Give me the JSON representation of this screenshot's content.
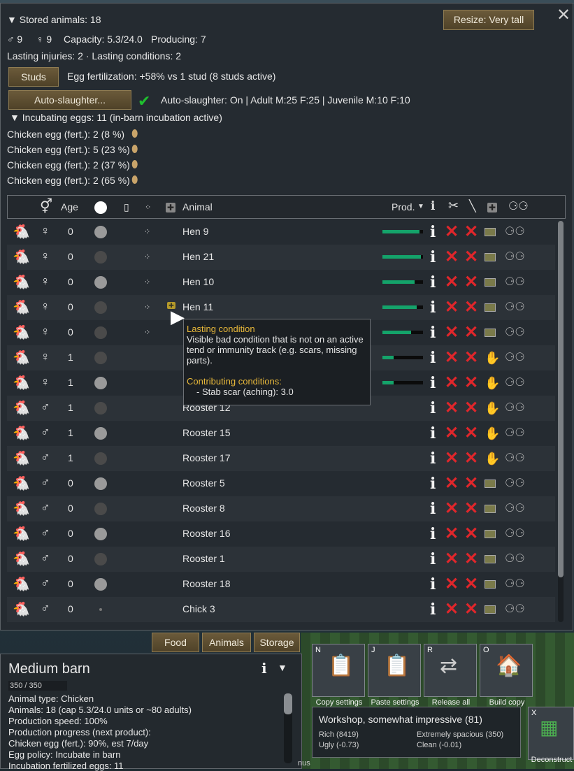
{
  "header_cut": "31557",
  "stored": "▼ Stored animals: 18",
  "resize_btn": "Resize: Very tall",
  "males": "9",
  "females": "9",
  "capacity": "Capacity: 5.3/24.0",
  "producing": "Producing: 7",
  "injuries": "Lasting injuries: 2 · Lasting conditions: 2",
  "studs_btn": "Studs",
  "egg_fert": "Egg fertilization: +58% vs 1 stud (8 studs active)",
  "autoslaughter_btn": "Auto-slaughter...",
  "autoslaughter_text": "Auto-slaughter: On | Adult M:25 F:25 | Juvenile M:10 F:10",
  "incubating": "▼ Incubating eggs: 11 (in-barn incubation active)",
  "eggs": [
    "Chicken egg (fert.): 2 (8 %)",
    "Chicken egg (fert.): 5 (23 %)",
    "Chicken egg (fert.): 2 (37 %)",
    "Chicken egg (fert.): 2 (65 %)"
  ],
  "columns": {
    "age": "Age",
    "animal": "Animal",
    "prod": "Prod."
  },
  "colors": {
    "bar": "#14a36a",
    "x": "#e0262b",
    "accent": "#e8b83a"
  },
  "animals": [
    {
      "sex": "♀",
      "age": "0",
      "name": "Hen 9",
      "circle": "#9a9a9a",
      "eggs": true,
      "prod": 0.92,
      "tend": "x",
      "icon": "hen-white"
    },
    {
      "sex": "♀",
      "age": "0",
      "name": "Hen 21",
      "circle": "#4a4a4a",
      "eggs": true,
      "prod": 0.95,
      "tend": "x",
      "icon": "hen-white"
    },
    {
      "sex": "♀",
      "age": "0",
      "name": "Hen 10",
      "circle": "#9a9a9a",
      "eggs": true,
      "prod": 0.8,
      "tend": "x",
      "icon": "hen-white"
    },
    {
      "sex": "♀",
      "age": "0",
      "name": "Hen 11",
      "circle": "#4a4a4a",
      "eggs": true,
      "prod": 0.85,
      "tend": "x",
      "icon": "hen-white",
      "condition": true
    },
    {
      "sex": "♀",
      "age": "0",
      "name": "",
      "circle": "#4a4a4a",
      "eggs": true,
      "prod": 0.7,
      "tend": "x",
      "icon": "hen-white"
    },
    {
      "sex": "♀",
      "age": "1",
      "name": "",
      "circle": "#4a4a4a",
      "eggs": false,
      "prod": 0.28,
      "tend": "hand",
      "icon": "hen-white"
    },
    {
      "sex": "♀",
      "age": "1",
      "name": "",
      "circle": "#9a9a9a",
      "eggs": false,
      "prod": 0.28,
      "tend": "hand",
      "icon": "hen-white"
    },
    {
      "sex": "♂",
      "age": "1",
      "name": "Rooster 12",
      "circle": "#4a4a4a",
      "eggs": false,
      "prod": null,
      "tend": "hand",
      "icon": "rooster"
    },
    {
      "sex": "♂",
      "age": "1",
      "name": "Rooster 15",
      "circle": "#9a9a9a",
      "eggs": false,
      "prod": null,
      "tend": "hand",
      "icon": "rooster"
    },
    {
      "sex": "♂",
      "age": "1",
      "name": "Rooster 17",
      "circle": "#4a4a4a",
      "eggs": false,
      "prod": null,
      "tend": "hand",
      "icon": "rooster"
    },
    {
      "sex": "♂",
      "age": "0",
      "name": "Rooster 5",
      "circle": "#9a9a9a",
      "eggs": false,
      "prod": null,
      "tend": "x",
      "icon": "rooster"
    },
    {
      "sex": "♂",
      "age": "0",
      "name": "Rooster 8",
      "circle": "#4a4a4a",
      "eggs": false,
      "prod": null,
      "tend": "x",
      "icon": "rooster"
    },
    {
      "sex": "♂",
      "age": "0",
      "name": "Rooster 16",
      "circle": "#9a9a9a",
      "eggs": false,
      "prod": null,
      "tend": "x",
      "icon": "rooster"
    },
    {
      "sex": "♂",
      "age": "0",
      "name": "Rooster 1",
      "circle": "#4a4a4a",
      "eggs": false,
      "prod": null,
      "tend": "x",
      "icon": "rooster"
    },
    {
      "sex": "♂",
      "age": "0",
      "name": "Rooster 18",
      "circle": "#9a9a9a",
      "eggs": false,
      "prod": null,
      "tend": "x",
      "icon": "rooster"
    },
    {
      "sex": "♂",
      "age": "0",
      "name": "Chick 3",
      "circle": "dot",
      "eggs": false,
      "prod": null,
      "tend": "x",
      "icon": "chick"
    }
  ],
  "tooltip": {
    "title": "Lasting condition",
    "body": "Visible bad condition that is not on an active tend or immunity track (e.g. scars, missing parts).",
    "sub": "Contributing conditions:",
    "item": "- Stab scar (aching): 3.0"
  },
  "tabs": [
    "Food",
    "Animals",
    "Storage"
  ],
  "inspect": {
    "title": "Medium barn",
    "hp": "350 / 350",
    "lines": [
      "Animal type: Chicken",
      "Animals: 18 (cap 5.3/24.0 units or ~80 adults)",
      "Production speed: 100%",
      "Production progress (next product):",
      "  Chicken egg (fert.): 90%, est 7/day",
      "Egg policy: Incubate in barn",
      "Incubation fertilized eggs: 11"
    ]
  },
  "commands": [
    {
      "key": "N",
      "label": "Copy settings"
    },
    {
      "key": "J",
      "label": "Paste settings"
    },
    {
      "key": "R",
      "label": "Release all animals"
    },
    {
      "key": "O",
      "label": "Build copy"
    },
    {
      "key": "X",
      "label": "Deconstruct"
    }
  ],
  "room": {
    "title": "Workshop, somewhat impressive (81)",
    "a": "Rich (8419)",
    "b": "Extremely spacious (350)",
    "c": "Ugly (-0.73)",
    "d": "Clean (-0.01)"
  },
  "misc": "nus"
}
